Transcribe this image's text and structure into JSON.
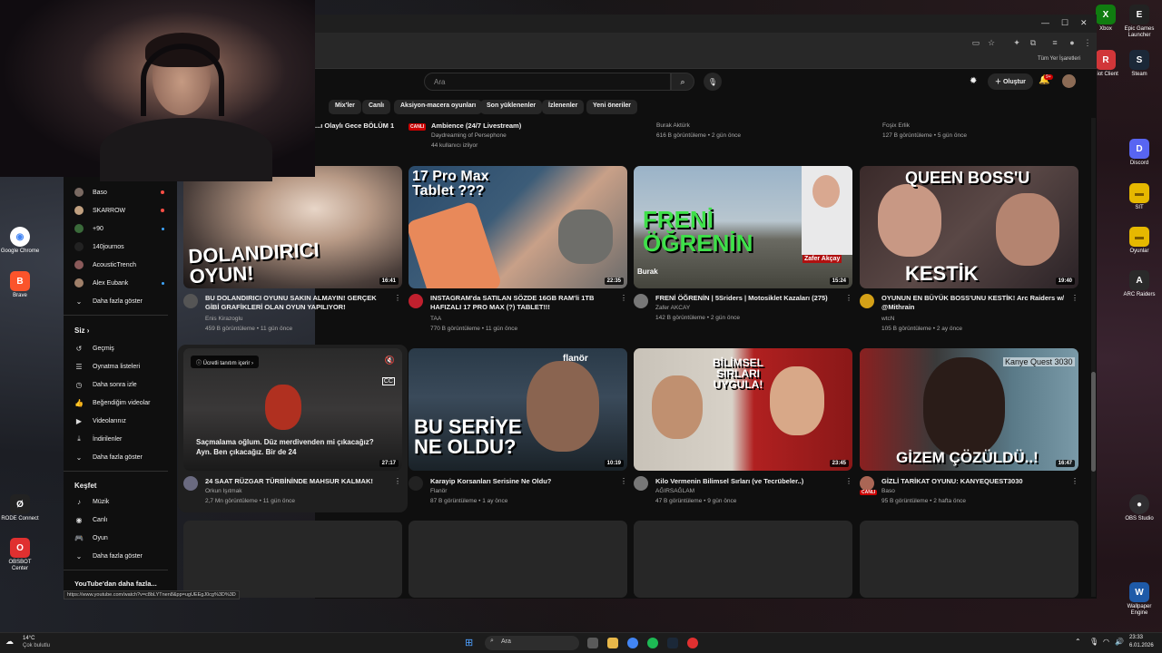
{
  "youtube": {
    "search_placeholder": "Ara",
    "create_label": "Oluştur",
    "notif_count": "9+",
    "chips": [
      "Mix'ler",
      "Canlı",
      "Aksiyon-macera oyunları",
      "Son yüklenenler",
      "İzlenenler",
      "Yeni öneriler"
    ]
  },
  "browser": {
    "bookmarks_label": "Tüm Yer İşaretleri"
  },
  "sidebar": {
    "subs": [
      {
        "name": "Baso",
        "indicator": "live"
      },
      {
        "name": "SKARROW",
        "indicator": "live"
      },
      {
        "name": "+90",
        "indicator": "dot"
      },
      {
        "name": "140journos",
        "indicator": "none"
      },
      {
        "name": "AcousticTrench",
        "indicator": "none"
      },
      {
        "name": "Alex Eubank",
        "indicator": "dot"
      }
    ],
    "show_more_1": "Daha fazla göster",
    "you_section": "Siz",
    "you_items": [
      "Geçmiş",
      "Oynatma listeleri",
      "Daha sonra izle",
      "Beğendiğim videolar",
      "Videolarınız",
      "İndirilenler"
    ],
    "show_more_2": "Daha fazla göster",
    "explore_section": "Keşfet",
    "explore_items": [
      "Müzik",
      "Canlı",
      "Oyun"
    ],
    "show_more_3": "Daha fazla göster",
    "more_from_yt": "YouTube'dan daha fazla..."
  },
  "top_row": [
    {
      "title": "...ı Olaylı Gece BÖLÜM 1",
      "channel": "",
      "meta": ""
    },
    {
      "title": "Ambience (24/7 Livestream)",
      "channel": "Daydreaming of Persephone",
      "meta": "44 kullanıcı izliyor",
      "badge": "CANLI"
    },
    {
      "title": "",
      "channel": "Burak Aktürk",
      "meta": "616 B görüntüleme • 2 gün önce"
    },
    {
      "title": "",
      "channel": "Foşix Erlik",
      "meta": "127 B görüntüleme • 5 gün önce"
    }
  ],
  "row1": [
    {
      "thumb_text": "DOLANDIRICI OYUN!",
      "duration": "16:41",
      "title": "BU DOLANDIRICI OYUNU SAKIN ALMAYIN! GERÇEK GİBİ GRAFİKLERİ OLAN OYUN YAPILIYOR!",
      "channel": "Enis Kirazoglu",
      "meta": "459 B görüntüleme • 11 gün önce"
    },
    {
      "thumb_text": "17 Pro Max Tablet ???",
      "duration": "22:35",
      "title": "INSTAGRAM'da SATILAN SÖZDE 16GB RAM'li 1TB HAFIZALI 17 PRO MAX (?) TABLET!!!",
      "channel": "TAA",
      "meta": "770 B görüntüleme • 11 gün önce"
    },
    {
      "thumb_text": "FRENİ ÖĞRENİN",
      "thumb_sub": "Zafer Akçay",
      "thumb_sub2": "Burak",
      "duration": "15:24",
      "title": "FRENİ ÖĞRENİN | 5Sriders | Motosiklet Kazaları (275)",
      "channel": "Zafer AKCAY",
      "meta": "142 B görüntüleme • 2 gün önce"
    },
    {
      "thumb_text": "QUEEN BOSS'U",
      "thumb_text2": "KESTİK",
      "duration": "19:40",
      "title": "OYUNUN EN BÜYÜK BOSS'UNU KESTİK! Arc Raiders w/ @Mithrain",
      "channel": "wtcN",
      "meta": "105 B görüntüleme • 2 ay önce"
    }
  ],
  "row2": [
    {
      "promo": "Ücretli tanıtım içerir",
      "caption": "Saçmalama oğlum. Düz merdivenden mi çıkacağız? Ayn. Ben çıkacağız. Bir de 24",
      "duration": "27:17",
      "title": "24 SAAT RÜZGAR TÜRBİNİNDE MAHSUR KALMAK!",
      "channel": "Orkun Işıtmak",
      "meta": "2,7 Mn görüntüleme • 11 gün önce"
    },
    {
      "thumb_text": "BU SERİYE NE OLDU?",
      "thumb_logo": "flanör",
      "duration": "10:19",
      "title": "Karayip Korsanları Serisine Ne Oldu?",
      "channel": "Flanör",
      "meta": "87 B görüntüleme • 1 ay önce"
    },
    {
      "thumb_text": "BİLİMSEL SIRLARI UYGULA!",
      "duration": "23:45",
      "title": "Kilo Vermenin Bilimsel Sırları (ve Tecrübeler..)",
      "channel": "AĞIRSAĞLAM",
      "meta": "47 B görüntüleme • 9 gün önce"
    },
    {
      "thumb_text": "GİZEM ÇÖZÜLDÜ..!",
      "thumb_sub": "Kanye Quest 3030",
      "duration": "16:47",
      "title": "GİZLİ TARİKAT OYUNU: KANYEQUEST3030",
      "channel": "Baso",
      "meta": "95 B görüntüleme • 2 hafta önce",
      "badge": "CANLI"
    }
  ],
  "status_url": "https://www.youtube.com/watch?v=c8bLYTnen8&pp=ugUEEgJ0cg%3D%3D",
  "desktop_icons_right": [
    {
      "label": "Xbox",
      "color": "#107c10",
      "glyph": "X"
    },
    {
      "label": "Epic Games Launcher",
      "color": "#222222",
      "glyph": "E"
    },
    {
      "label": "Riot Client",
      "color": "#d13639",
      "glyph": "R"
    },
    {
      "label": "Steam",
      "color": "#1b2838",
      "glyph": "S"
    },
    {
      "label": "Discord",
      "color": "#5865f2",
      "glyph": "D"
    },
    {
      "label": "SIT",
      "color": "#e6b800",
      "glyph": "▬"
    },
    {
      "label": "Oyunlar",
      "color": "#e6b800",
      "glyph": "▬"
    },
    {
      "label": "ARC Raiders",
      "color": "#2a2a2a",
      "glyph": "A"
    },
    {
      "label": "OBS Studio",
      "color": "#302e31",
      "glyph": "●"
    },
    {
      "label": "Wallpaper Engine",
      "color": "#1e5aa8",
      "glyph": "W"
    }
  ],
  "desktop_icons_left": [
    {
      "label": "Google Chrome",
      "color": "#4285f4",
      "glyph": "◉"
    },
    {
      "label": "Brave",
      "color": "#fb542b",
      "glyph": "B"
    },
    {
      "label": "RODE Connect",
      "color": "#222222",
      "glyph": "Ø"
    },
    {
      "label": "OBSBOT Center",
      "color": "#e03030",
      "glyph": "O"
    }
  ],
  "taskbar": {
    "weather_temp": "14°C",
    "weather_desc": "Çok bulutlu",
    "search_label": "Ara",
    "time": "23:33",
    "date": "6.01.2026"
  },
  "colors": {
    "live": "#cc0000",
    "accent_red": "#ff0033",
    "link_blue": "#3ea6ff"
  }
}
